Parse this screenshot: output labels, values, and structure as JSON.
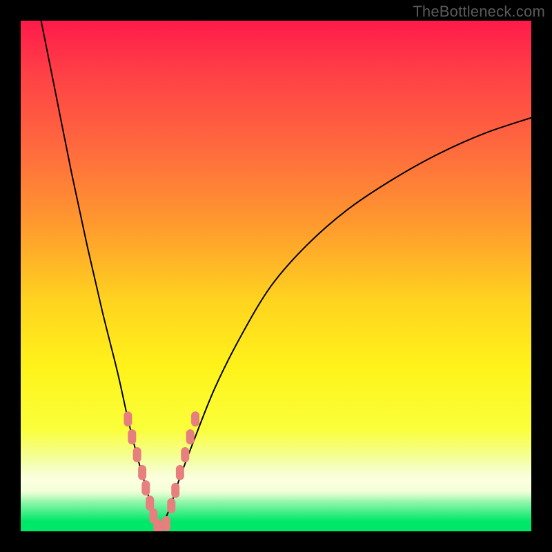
{
  "attribution": "TheBottleneck.com",
  "chart_data": {
    "type": "line",
    "title": "",
    "xlabel": "",
    "ylabel": "",
    "xlim": [
      0,
      100
    ],
    "ylim": [
      0,
      100
    ],
    "grid": false,
    "legend": false,
    "gradient_colors": {
      "top": "#ff1a4b",
      "mid_upper": "#ff9a2e",
      "mid": "#fff31a",
      "band": "#f5ffc8",
      "bottom": "#00e86a"
    },
    "series": [
      {
        "name": "left-branch",
        "kind": "curve",
        "x": [
          4,
          7,
          10,
          13,
          16,
          19,
          21,
          23,
          25,
          26,
          27
        ],
        "y": [
          100,
          85,
          70,
          56,
          43,
          31,
          22,
          14,
          7,
          3,
          0
        ]
      },
      {
        "name": "right-branch",
        "kind": "curve",
        "x": [
          27,
          29,
          31,
          34,
          38,
          43,
          49,
          56,
          64,
          73,
          82,
          91,
          100
        ],
        "y": [
          0,
          4,
          10,
          18,
          28,
          38,
          48,
          56,
          63,
          69,
          74,
          78,
          81
        ]
      },
      {
        "name": "markers-left",
        "kind": "markers",
        "x": [
          21.0,
          21.8,
          22.8,
          23.8,
          24.5,
          25.3,
          26.0,
          26.8
        ],
        "y": [
          22.0,
          18.5,
          15.0,
          11.5,
          8.5,
          5.5,
          3.0,
          1.0
        ]
      },
      {
        "name": "markers-bottom",
        "kind": "markers",
        "x": [
          27.0,
          28.5
        ],
        "y": [
          0.5,
          1.5
        ]
      },
      {
        "name": "markers-right",
        "kind": "markers",
        "x": [
          29.5,
          30.3,
          31.2,
          32.2,
          33.2,
          34.2
        ],
        "y": [
          5.0,
          8.0,
          11.5,
          15.0,
          18.5,
          22.0
        ]
      }
    ]
  }
}
